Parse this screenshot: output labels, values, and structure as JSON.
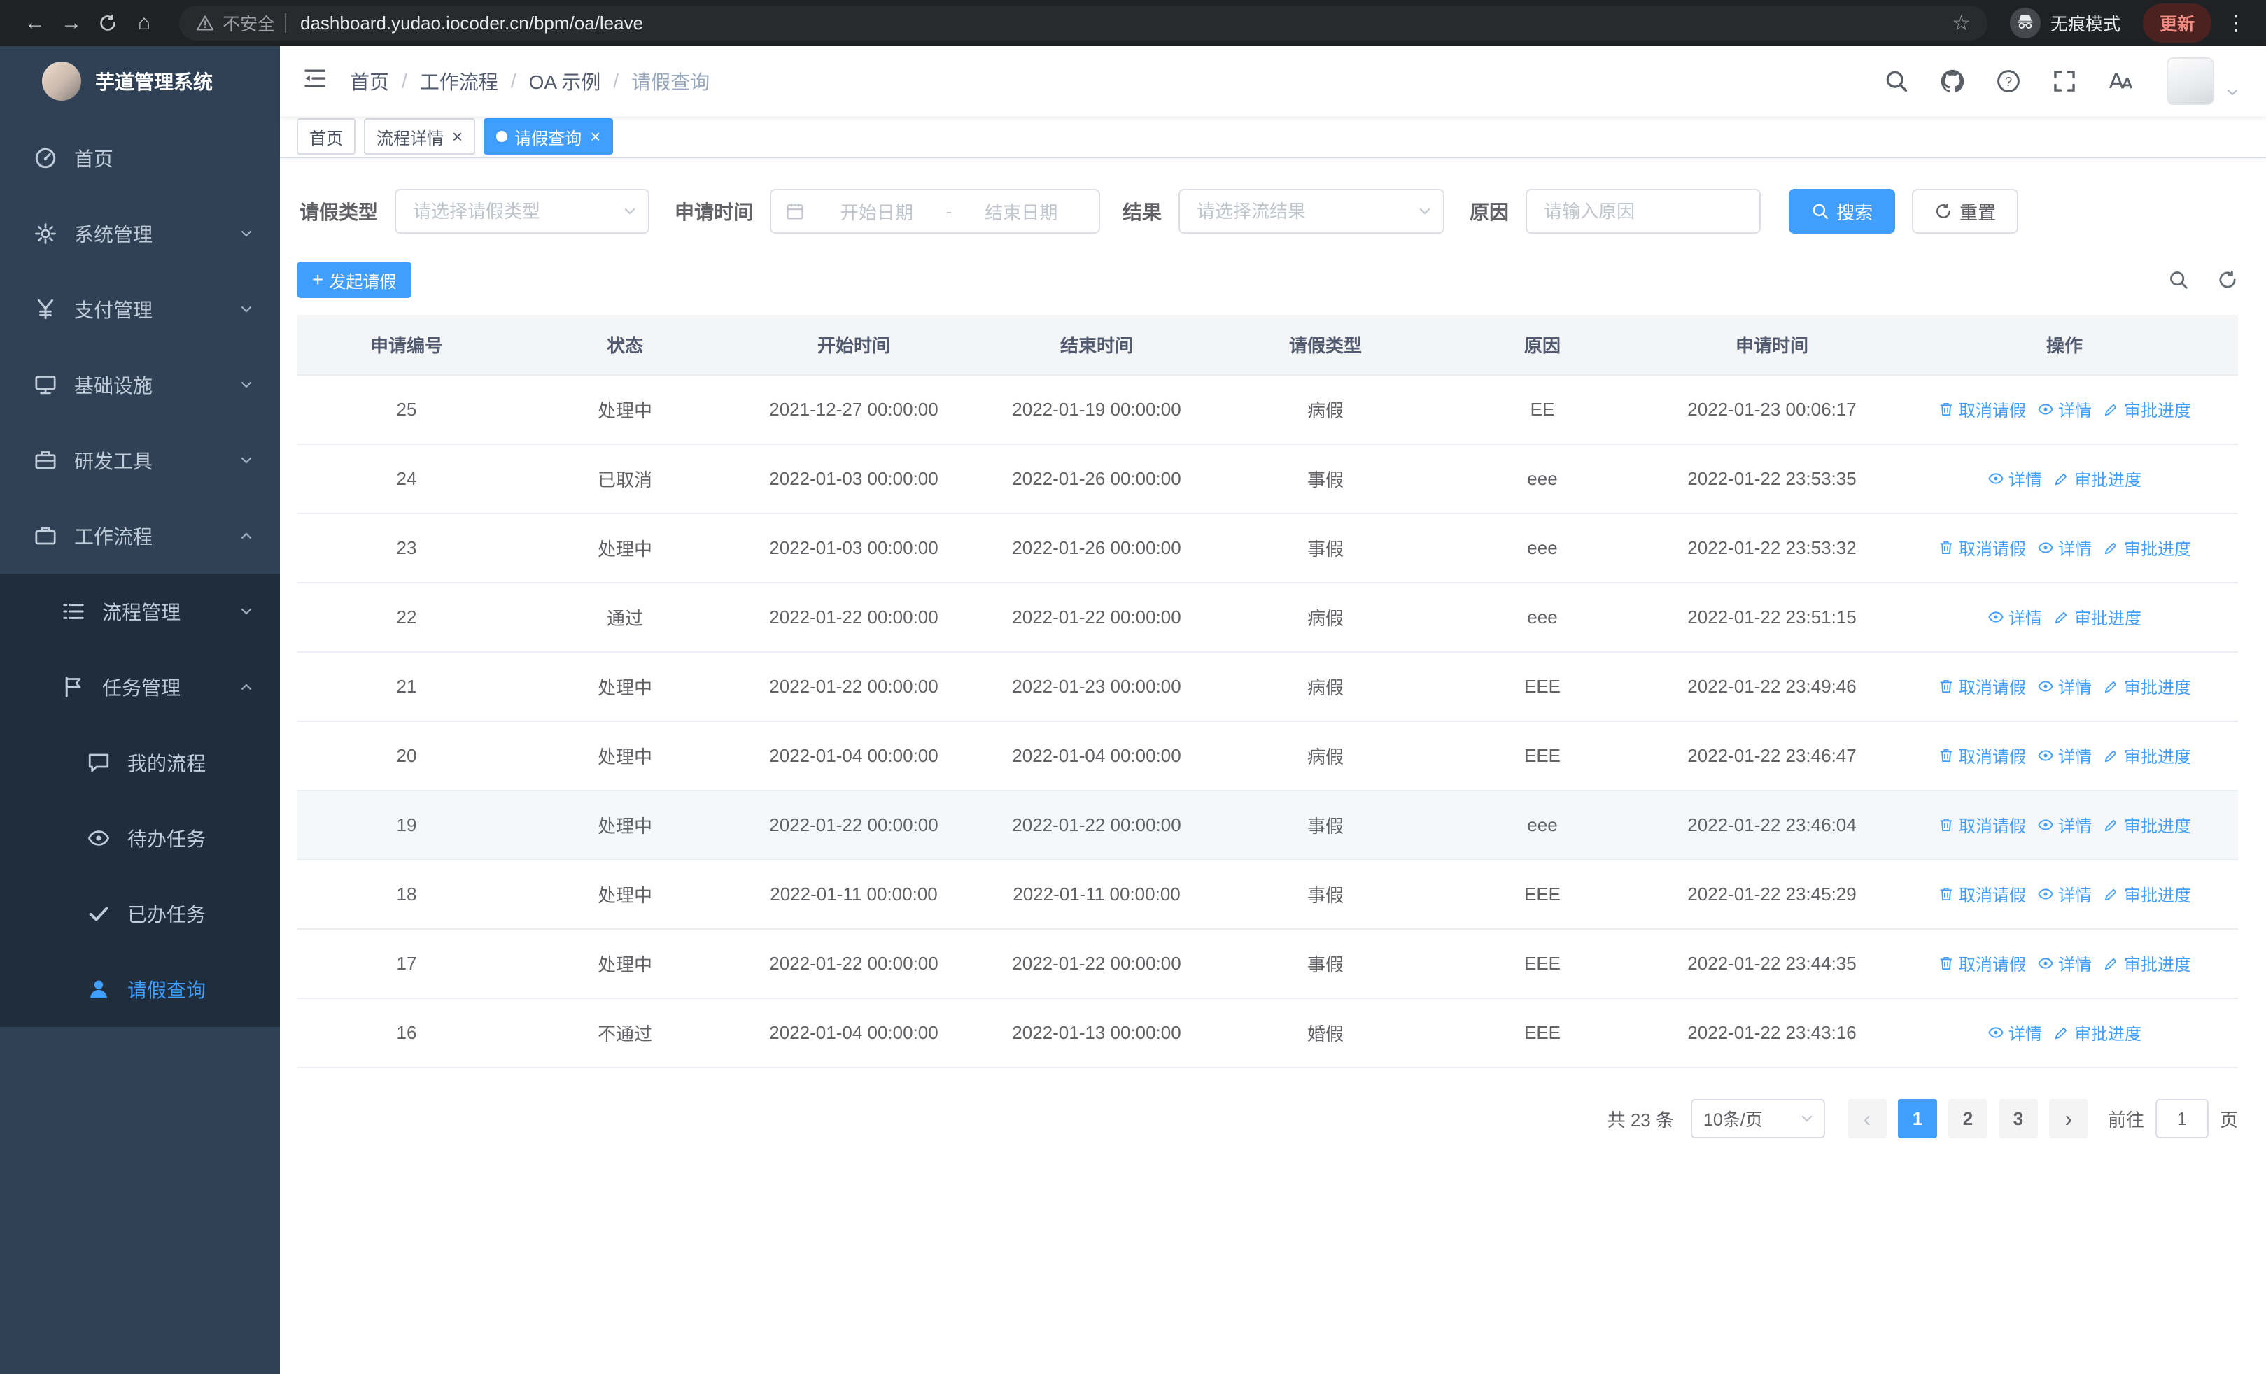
{
  "theme": {
    "accent": "#409eff",
    "sidebar-bg": "#304156",
    "sidebar-sub-bg": "#1f2d3d",
    "sidebar-text": "#bfcbd9",
    "browser-bar-bg": "#202124"
  },
  "browser": {
    "back_glyph": "←",
    "forward_glyph": "→",
    "home_glyph": "⌂",
    "security_label": "不安全",
    "url": "dashboard.yudao.iocoder.cn/bpm/oa/leave",
    "bookmark_glyph": "☆",
    "incognito_label": "无痕模式",
    "update_label": "更新",
    "menu_glyph": "⋮"
  },
  "sidebar": {
    "logo_title": "芋道管理系统",
    "menu": [
      {
        "id": "home",
        "label": "首页",
        "icon": "dashboard",
        "level": 1
      },
      {
        "id": "system",
        "label": "系统管理",
        "icon": "gear",
        "level": 1,
        "arrow": "down"
      },
      {
        "id": "payment",
        "label": "支付管理",
        "icon": "yen",
        "level": 1,
        "arrow": "down"
      },
      {
        "id": "infra",
        "label": "基础设施",
        "icon": "monitor",
        "level": 1,
        "arrow": "down"
      },
      {
        "id": "devtools",
        "label": "研发工具",
        "icon": "tools",
        "level": 1,
        "arrow": "down"
      },
      {
        "id": "workflow",
        "label": "工作流程",
        "icon": "briefcase",
        "level": 1,
        "arrow": "up",
        "open": true
      },
      {
        "id": "process-mgmt",
        "label": "流程管理",
        "icon": "list",
        "level": 2,
        "arrow": "down"
      },
      {
        "id": "task-mgmt",
        "label": "任务管理",
        "icon": "flag",
        "level": 2,
        "arrow": "up",
        "open": true
      },
      {
        "id": "my-process",
        "label": "我的流程",
        "icon": "chat",
        "level": 3
      },
      {
        "id": "todo-task",
        "label": "待办任务",
        "icon": "eye",
        "level": 3
      },
      {
        "id": "done-task",
        "label": "已办任务",
        "icon": "check",
        "level": 3
      },
      {
        "id": "leave-query",
        "label": "请假查询",
        "icon": "user",
        "level": 3,
        "active": true
      }
    ]
  },
  "header": {
    "breadcrumb": [
      "首页",
      "工作流程",
      "OA 示例",
      "请假查询"
    ]
  },
  "tabs": [
    {
      "id": "home",
      "label": "首页",
      "closable": false,
      "active": false
    },
    {
      "id": "process-detail",
      "label": "流程详情",
      "closable": true,
      "active": false
    },
    {
      "id": "leave-query",
      "label": "请假查询",
      "closable": true,
      "active": true
    }
  ],
  "filters": {
    "leave_type_label": "请假类型",
    "leave_type_placeholder": "请选择请假类型",
    "apply_time_label": "申请时间",
    "start_placeholder": "开始日期",
    "range_separator": "-",
    "end_placeholder": "结束日期",
    "result_label": "结果",
    "result_placeholder": "请选择流结果",
    "reason_label": "原因",
    "reason_placeholder": "请输入原因",
    "search_label": "搜索",
    "reset_label": "重置"
  },
  "toolbar": {
    "create_label": "发起请假"
  },
  "table": {
    "columns": [
      "申请编号",
      "状态",
      "开始时间",
      "结束时间",
      "请假类型",
      "原因",
      "申请时间",
      "操作"
    ],
    "action_labels": {
      "cancel": "取消请假",
      "detail": "详情",
      "progress": "审批进度"
    },
    "rows": [
      {
        "id": "25",
        "status": "处理中",
        "start": "2021-12-27 00:00:00",
        "end": "2022-01-19 00:00:00",
        "type": "病假",
        "reason": "EE",
        "applied": "2022-01-23 00:06:17",
        "actions": [
          "cancel",
          "detail",
          "progress"
        ]
      },
      {
        "id": "24",
        "status": "已取消",
        "start": "2022-01-03 00:00:00",
        "end": "2022-01-26 00:00:00",
        "type": "事假",
        "reason": "eee",
        "applied": "2022-01-22 23:53:35",
        "actions": [
          "detail",
          "progress"
        ]
      },
      {
        "id": "23",
        "status": "处理中",
        "start": "2022-01-03 00:00:00",
        "end": "2022-01-26 00:00:00",
        "type": "事假",
        "reason": "eee",
        "applied": "2022-01-22 23:53:32",
        "actions": [
          "cancel",
          "detail",
          "progress"
        ]
      },
      {
        "id": "22",
        "status": "通过",
        "start": "2022-01-22 00:00:00",
        "end": "2022-01-22 00:00:00",
        "type": "病假",
        "reason": "eee",
        "applied": "2022-01-22 23:51:15",
        "actions": [
          "detail",
          "progress"
        ]
      },
      {
        "id": "21",
        "status": "处理中",
        "start": "2022-01-22 00:00:00",
        "end": "2022-01-23 00:00:00",
        "type": "病假",
        "reason": "EEE",
        "applied": "2022-01-22 23:49:46",
        "actions": [
          "cancel",
          "detail",
          "progress"
        ]
      },
      {
        "id": "20",
        "status": "处理中",
        "start": "2022-01-04 00:00:00",
        "end": "2022-01-04 00:00:00",
        "type": "病假",
        "reason": "EEE",
        "applied": "2022-01-22 23:46:47",
        "actions": [
          "cancel",
          "detail",
          "progress"
        ]
      },
      {
        "id": "19",
        "status": "处理中",
        "start": "2022-01-22 00:00:00",
        "end": "2022-01-22 00:00:00",
        "type": "事假",
        "reason": "eee",
        "applied": "2022-01-22 23:46:04",
        "actions": [
          "cancel",
          "detail",
          "progress"
        ],
        "highlight": true
      },
      {
        "id": "18",
        "status": "处理中",
        "start": "2022-01-11 00:00:00",
        "end": "2022-01-11 00:00:00",
        "type": "事假",
        "reason": "EEE",
        "applied": "2022-01-22 23:45:29",
        "actions": [
          "cancel",
          "detail",
          "progress"
        ]
      },
      {
        "id": "17",
        "status": "处理中",
        "start": "2022-01-22 00:00:00",
        "end": "2022-01-22 00:00:00",
        "type": "事假",
        "reason": "EEE",
        "applied": "2022-01-22 23:44:35",
        "actions": [
          "cancel",
          "detail",
          "progress"
        ]
      },
      {
        "id": "16",
        "status": "不通过",
        "start": "2022-01-04 00:00:00",
        "end": "2022-01-13 00:00:00",
        "type": "婚假",
        "reason": "EEE",
        "applied": "2022-01-22 23:43:16",
        "actions": [
          "detail",
          "progress"
        ]
      }
    ]
  },
  "pagination": {
    "total_label": "共 23 条",
    "page_size_label": "10条/页",
    "prev_glyph": "‹",
    "next_glyph": "›",
    "pages": [
      "1",
      "2",
      "3"
    ],
    "active_page": "1",
    "goto_prefix": "前往",
    "goto_value": "1",
    "goto_suffix": "页"
  }
}
